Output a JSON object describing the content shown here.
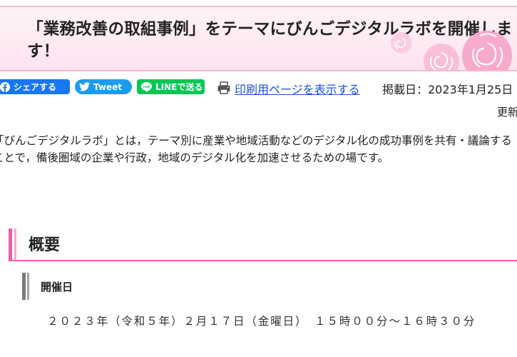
{
  "page": {
    "title": "「業務改善の取組事例」をテーマにびんごデジタルラボを開催します！"
  },
  "share": {
    "facebook_label": "シェアする",
    "tweet_label": "Tweet",
    "line_label": "LINEで送る",
    "print_label": "印刷用ページを表示する",
    "published_label": "掲載日：2023年1月25日",
    "updated_label": "更新"
  },
  "intro": {
    "text": "「びんごデジタルラボ」とは，テーマ別に産業や地域活動などのデジタル化の成功事例を共有・議論することで，備後圏域の企業や行政，地域のデジタル化を加速させるための場です。"
  },
  "overview": {
    "heading": "概要",
    "date_heading": "開催日",
    "date_text": "２０２３年（令和５年）２月１７日（金曜日）　１５時００分～１６時３０分"
  },
  "colors": {
    "accent_pink": "#ec5ea9",
    "banner_bg": "#fde3ef",
    "facebook": "#1877f2",
    "twitter": "#1d9bf0",
    "line": "#06c755",
    "link": "#1a4fd6"
  },
  "icons": {
    "facebook": "facebook-icon",
    "twitter": "twitter-bird-icon",
    "line": "line-chat-icon",
    "print": "printer-icon",
    "decoration": "rose-icon"
  }
}
